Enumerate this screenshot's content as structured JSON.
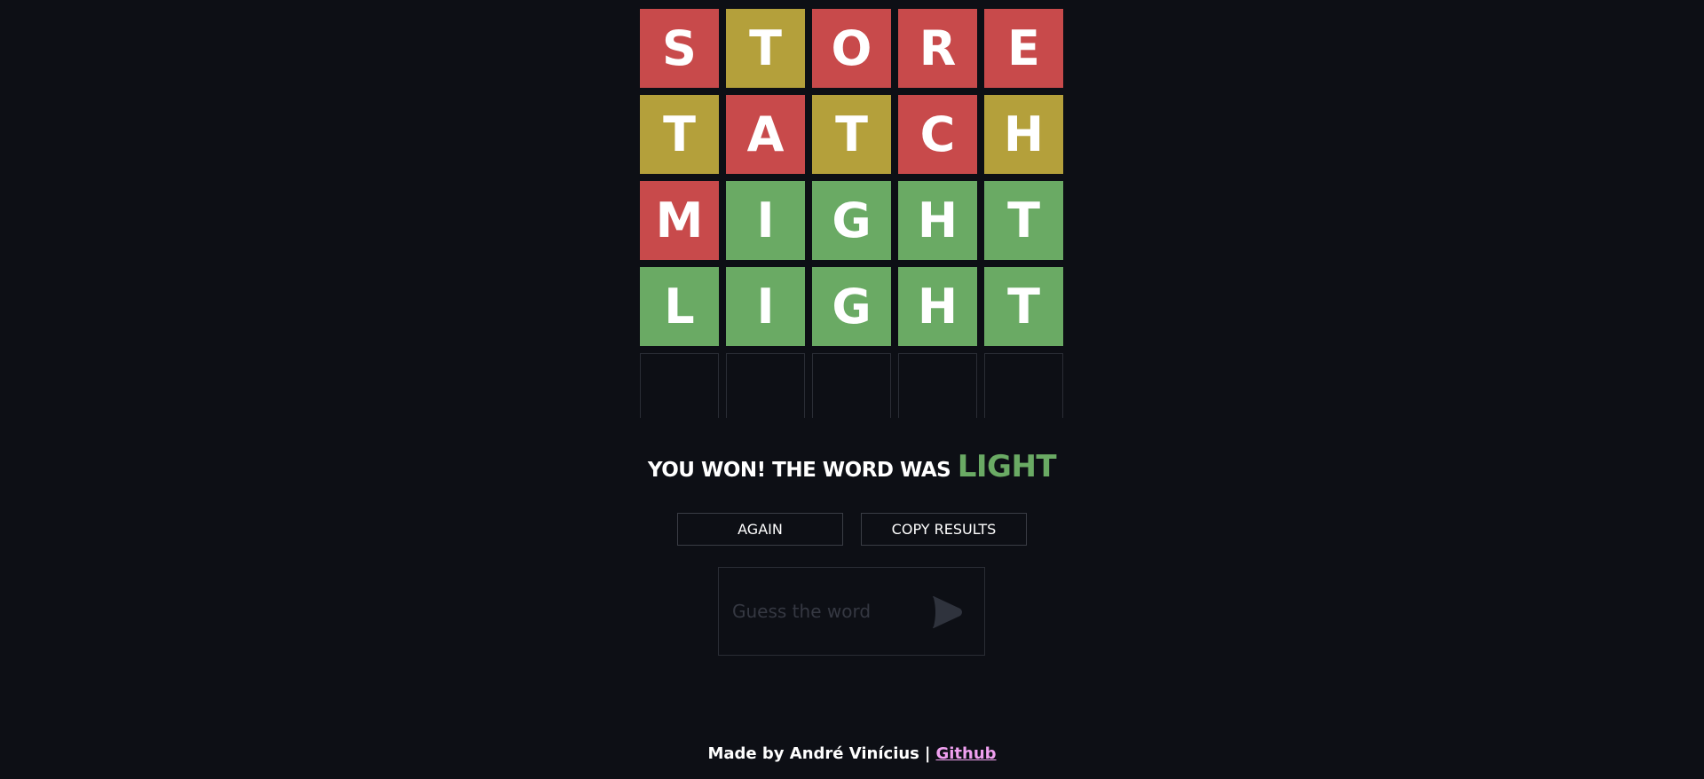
{
  "board": {
    "rows": [
      [
        {
          "letter": "S",
          "state": "red"
        },
        {
          "letter": "T",
          "state": "yellow"
        },
        {
          "letter": "O",
          "state": "red"
        },
        {
          "letter": "R",
          "state": "red"
        },
        {
          "letter": "E",
          "state": "red"
        }
      ],
      [
        {
          "letter": "T",
          "state": "yellow"
        },
        {
          "letter": "A",
          "state": "red"
        },
        {
          "letter": "T",
          "state": "yellow"
        },
        {
          "letter": "C",
          "state": "red"
        },
        {
          "letter": "H",
          "state": "yellow"
        }
      ],
      [
        {
          "letter": "M",
          "state": "red"
        },
        {
          "letter": "I",
          "state": "green"
        },
        {
          "letter": "G",
          "state": "green"
        },
        {
          "letter": "H",
          "state": "green"
        },
        {
          "letter": "T",
          "state": "green"
        }
      ],
      [
        {
          "letter": "L",
          "state": "green"
        },
        {
          "letter": "I",
          "state": "green"
        },
        {
          "letter": "G",
          "state": "green"
        },
        {
          "letter": "H",
          "state": "green"
        },
        {
          "letter": "T",
          "state": "green"
        }
      ],
      [
        {
          "letter": "",
          "state": "blank"
        },
        {
          "letter": "",
          "state": "blank"
        },
        {
          "letter": "",
          "state": "blank"
        },
        {
          "letter": "",
          "state": "blank"
        },
        {
          "letter": "",
          "state": "blank"
        }
      ]
    ]
  },
  "colors": {
    "background": "#0d0f15",
    "red": "#c84a4b",
    "yellow": "#b4a03b",
    "green": "#6aaa64",
    "link": "#f0a0f0"
  },
  "result": {
    "prefix": "YOU WON! THE WORD WAS",
    "word": "LIGHT"
  },
  "buttons": {
    "again": "AGAIN",
    "copy": "COPY RESULTS"
  },
  "guess": {
    "placeholder": "Guess the word",
    "value": "",
    "send_icon": "send-play-icon"
  },
  "footer": {
    "credit": "Made by André Vinícius",
    "separator": "|",
    "link_text": "Github"
  }
}
